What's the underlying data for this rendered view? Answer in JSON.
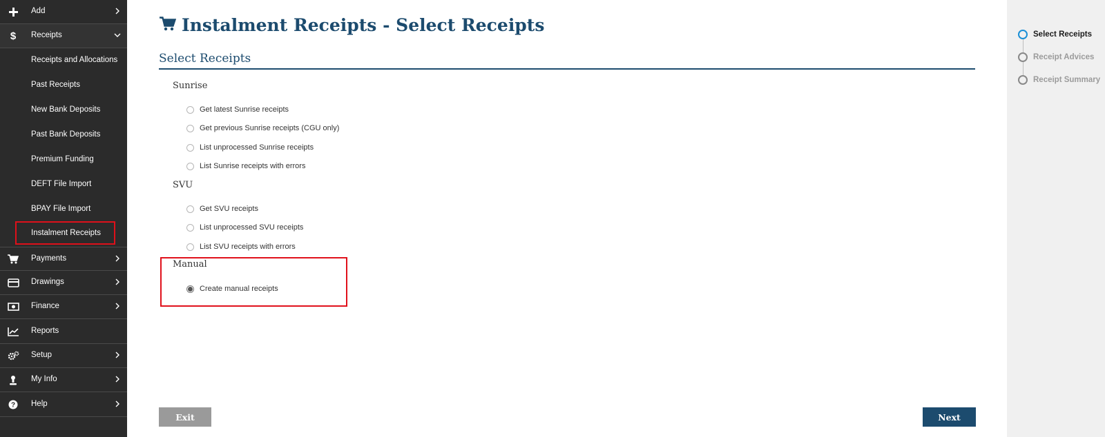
{
  "sidebar": {
    "items": [
      {
        "label": "Add",
        "icon": "plus-icon"
      },
      {
        "label": "Receipts",
        "icon": "dollar-icon"
      },
      {
        "label": "Payments",
        "icon": "cart-icon"
      },
      {
        "label": "Drawings",
        "icon": "card-icon"
      },
      {
        "label": "Finance",
        "icon": "money-icon"
      },
      {
        "label": "Reports",
        "icon": "chart-icon"
      },
      {
        "label": "Setup",
        "icon": "gears-icon"
      },
      {
        "label": "My Info",
        "icon": "user-icon"
      },
      {
        "label": "Help",
        "icon": "help-icon"
      }
    ],
    "receipts_sub": [
      "Receipts and Allocations",
      "Past Receipts",
      "New Bank Deposits",
      "Past Bank Deposits",
      "Premium Funding",
      "DEFT File Import",
      "BPAY File Import",
      "Instalment Receipts"
    ]
  },
  "main": {
    "title": "Instalment Receipts - Select Receipts",
    "section_title": "Select Receipts",
    "groups": {
      "sunrise": {
        "label": "Sunrise",
        "options": [
          "Get latest Sunrise receipts",
          "Get previous Sunrise receipts (CGU only)",
          "List unprocessed Sunrise receipts",
          "List Sunrise receipts with errors"
        ]
      },
      "svu": {
        "label": "SVU",
        "options": [
          "Get SVU receipts",
          "List unprocessed SVU receipts",
          "List SVU receipts with errors"
        ]
      },
      "manual": {
        "label": "Manual",
        "options": [
          "Create manual receipts"
        ],
        "selected": "Create manual receipts"
      }
    },
    "buttons": {
      "exit": "Exit",
      "next": "Next"
    }
  },
  "stepper": {
    "steps": [
      "Select Receipts",
      "Receipt Advices",
      "Receipt Summary"
    ],
    "active": "Select Receipts"
  },
  "colors": {
    "sidebar_bg": "#2b2b2b",
    "title": "#1c4b6e",
    "highlight_border": "#e0101a",
    "step_active": "#1a8fd6",
    "exit_button": "#9a9a9a",
    "next_button": "#1c4b6e"
  }
}
